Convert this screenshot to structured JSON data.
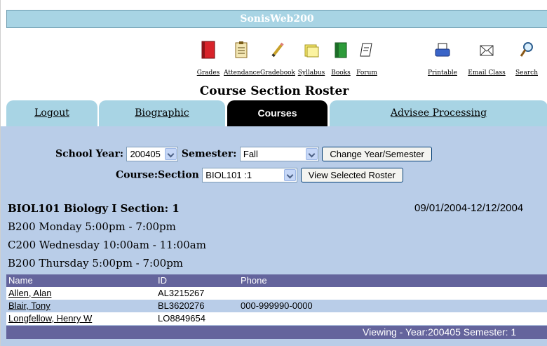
{
  "app": {
    "title": "SonisWeb200"
  },
  "toolbar": {
    "items": [
      {
        "label": "Grades",
        "icon": "grades-book-icon"
      },
      {
        "label": "Attendance",
        "icon": "attendance-clipboard-icon"
      },
      {
        "label": "Gradebook",
        "icon": "gradebook-pencil-icon"
      },
      {
        "label": "Syllabus",
        "icon": "syllabus-notes-icon"
      },
      {
        "label": "Books",
        "icon": "books-icon"
      },
      {
        "label": "Forum",
        "icon": "forum-icon"
      },
      {
        "label": "Printable",
        "icon": "printer-icon"
      },
      {
        "label": "Email Class",
        "icon": "envelope-icon"
      },
      {
        "label": "Search",
        "icon": "magnifier-icon"
      }
    ]
  },
  "page_title": "Course Section Roster",
  "tabs": [
    {
      "label": "Logout",
      "active": false
    },
    {
      "label": "Biographic",
      "active": false
    },
    {
      "label": "Courses",
      "active": true
    },
    {
      "label": "Advisee Processing",
      "active": false
    }
  ],
  "form": {
    "school_year_label": "School Year:",
    "school_year_value": "200405",
    "semester_label": "Semester:",
    "semester_value": "Fall",
    "change_button": "Change Year/Semester",
    "course_section_label": "Course:Section",
    "course_section_value": "BIOL101 :1",
    "view_button": "View Selected Roster"
  },
  "course": {
    "title": "BIOL101 Biology I Section: 1",
    "date_range": "09/01/2004-12/12/2004",
    "schedule": [
      "B200 Monday 5:00pm - 7:00pm",
      "C200 Wednesday 10:00am - 11:00am",
      "B200 Thursday 5:00pm - 7:00pm"
    ]
  },
  "roster": {
    "headers": {
      "name": "Name",
      "id": "ID",
      "phone": "Phone"
    },
    "rows": [
      {
        "name": "Allen, Alan",
        "id": "AL3215267",
        "phone": ""
      },
      {
        "name": "Blair, Tony",
        "id": "BL3620276",
        "phone": "000-999990-0000"
      },
      {
        "name": "Longfellow, Henry W",
        "id": "LO8849654",
        "phone": ""
      }
    ]
  },
  "footer": {
    "status": "Viewing - Year:200405 Semester: 1"
  },
  "colors": {
    "title_bar": "#a8d4e4",
    "tab": "#a8d4e4",
    "tab_active": "#000000",
    "panel": "#b9cde8",
    "table_header": "#64649c"
  }
}
